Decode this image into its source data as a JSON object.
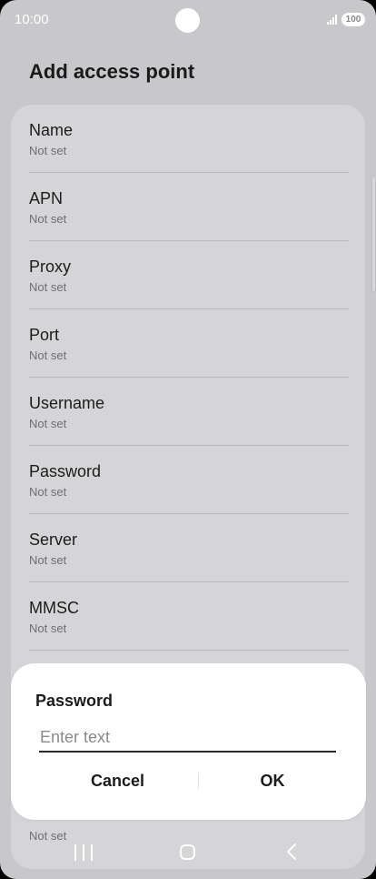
{
  "status_bar": {
    "time": "10:00",
    "battery": "100",
    "icons": [
      "signal-icon",
      "battery-icon"
    ]
  },
  "header": {
    "title": "Add access point"
  },
  "settings": {
    "items": [
      {
        "label": "Name",
        "value": "Not set"
      },
      {
        "label": "APN",
        "value": "Not set"
      },
      {
        "label": "Proxy",
        "value": "Not set"
      },
      {
        "label": "Port",
        "value": "Not set"
      },
      {
        "label": "Username",
        "value": "Not set"
      },
      {
        "label": "Password",
        "value": "Not set"
      },
      {
        "label": "Server",
        "value": "Not set"
      },
      {
        "label": "MMSC",
        "value": "Not set"
      }
    ],
    "peek_value": "Not set"
  },
  "dialog": {
    "title": "Password",
    "input_placeholder": "Enter text",
    "input_value": "",
    "cancel_label": "Cancel",
    "ok_label": "OK"
  },
  "nav_bar": {
    "icons": [
      "recents-icon",
      "home-icon",
      "back-icon"
    ]
  },
  "colors": {
    "dim_background": "#c8c8ca",
    "card": "#d5d5d7",
    "dialog": "#ffffff",
    "text": "#1c1c1c",
    "secondary_text": "#6f6f71"
  }
}
